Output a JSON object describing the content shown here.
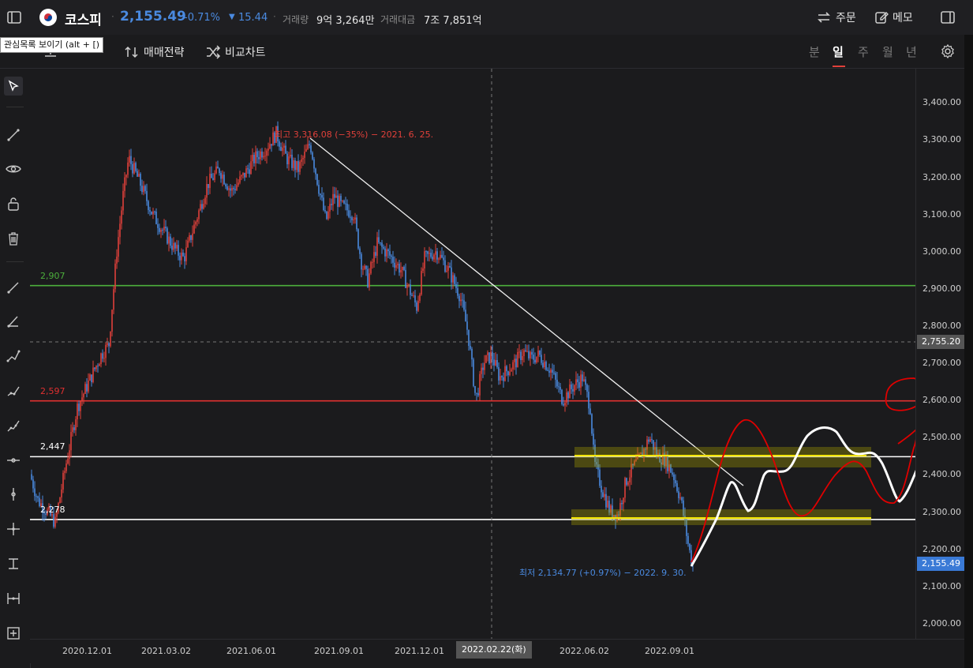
{
  "header": {
    "index_name": "코스피",
    "price": "2,155.49",
    "change_pct": "-0.71%",
    "change_pts": "15.44",
    "volume_label": "거래량",
    "volume_value": "9억 3,264만",
    "amount_label": "거래대금",
    "amount_value": "7조 7,851억",
    "order_label": "주문",
    "memo_label": "메모"
  },
  "tooltip": "관심목록 보이기 (alt + [)",
  "toolbar": {
    "strategy_label": "매매전략",
    "compare_label": "비교차트",
    "timeframes": [
      "분",
      "일",
      "주",
      "월",
      "년"
    ],
    "active_timeframe": "일"
  },
  "left_tools": [
    "cursor-icon",
    "trendline-icon",
    "eye-icon",
    "unlock-icon",
    "trash-icon",
    "ray-icon",
    "angle-icon",
    "polyline-icon",
    "multi-line-icon",
    "channel-icon",
    "horizontal-line-icon",
    "vertical-line-icon",
    "crosshair-icon",
    "text-icon",
    "measure-icon",
    "add-icon"
  ],
  "chart": {
    "high_annotation": "최고 3,316.08 (−35%) − 2021. 6. 25.",
    "low_annotation": "최저 2,134.77 (+0.97%) − 2022. 9. 30.",
    "levels": [
      {
        "label": "2,907",
        "value": 2907,
        "color": "#4caf3c"
      },
      {
        "label": "2,597",
        "value": 2597,
        "color": "#e03030"
      },
      {
        "label": "2,447",
        "value": 2447,
        "color": "#ffffff"
      },
      {
        "label": "2,278",
        "value": 2278,
        "color": "#ffffff"
      }
    ],
    "crosshair_price": "2,755.20",
    "crosshair_date": "2022.02.22(화)",
    "current_price_tag": "2,155.49",
    "y_ticks": [
      "3,400.00",
      "3,300.00",
      "3,200.00",
      "3,100.00",
      "3,000.00",
      "2,900.00",
      "2,800.00",
      "2,700.00",
      "2,600.00",
      "2,500.00",
      "2,400.00",
      "2,300.00",
      "2,200.00",
      "2,100.00",
      "2,000.00"
    ],
    "x_ticks": [
      "2020.12.01",
      "2021.03.02",
      "2021.06.01",
      "2021.09.01",
      "2021.12.01",
      "2022.06.02",
      "2022.09.01"
    ],
    "colors": {
      "up": "#e0403a",
      "down": "#4a8ae0",
      "accent_blue": "#4a8ae0"
    }
  }
}
